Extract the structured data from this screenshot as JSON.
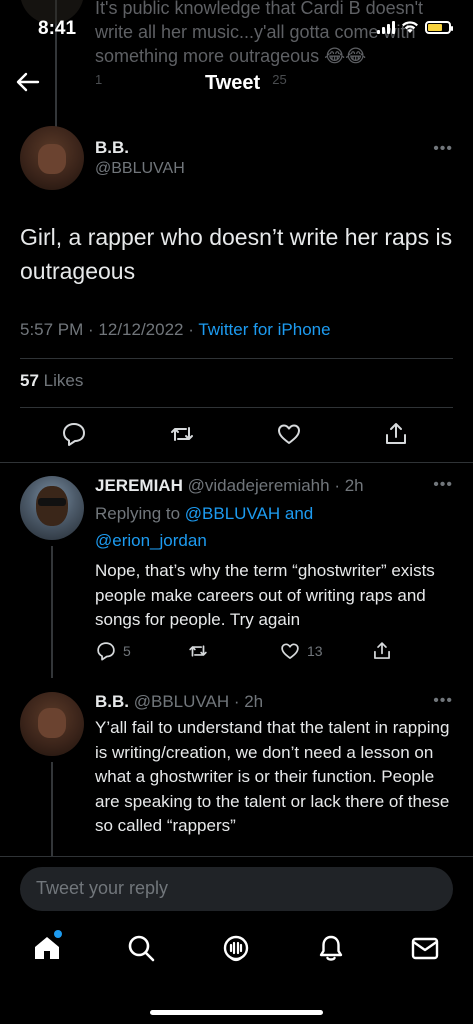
{
  "status_bar": {
    "time": "8:41"
  },
  "ghost_tweet": {
    "text": "It's public knowledge that Cardi B doesn't write all her music...y'all gotta come with something more outrageous 😂😂",
    "reply_count": "1",
    "like_count": "25"
  },
  "header": {
    "title": "Tweet"
  },
  "main_tweet": {
    "name": "B.B.",
    "handle": "@BBLUVAH",
    "text": "Girl, a rapper who doesn’t write her raps is outrageous",
    "time": "5:57 PM · 12/12/2022 · ",
    "source": "Twitter for iPhone",
    "likes_count": "57",
    "likes_label": " Likes"
  },
  "replies": [
    {
      "name": "JEREMIAH",
      "handle": "@vidadejeremiahh · 2h",
      "replying_prefix": "Replying to ",
      "replying_to_1": "@BBLUVAH and",
      "replying_to_2": "@erion_jordan",
      "text": "Nope, that’s why the term “ghostwriter” exists people make careers out of writing raps and songs for people. Try again",
      "reply_count": "5",
      "retweet_count": "",
      "like_count": "13"
    },
    {
      "name": "B.B.",
      "handle": "@BBLUVAH · 2h",
      "text": "Y’all fail to understand that the talent in rapping is writing/creation, we don’t need a lesson on what a ghostwriter is or their function. People are speaking to the talent or lack there of these so called “rappers”"
    }
  ],
  "reply_input": {
    "placeholder": "Tweet your reply"
  },
  "tabbar": {
    "items": [
      "home-icon",
      "search-icon",
      "spaces-icon",
      "notifications-icon",
      "messages-icon"
    ],
    "accent": "#1d9bf0"
  }
}
